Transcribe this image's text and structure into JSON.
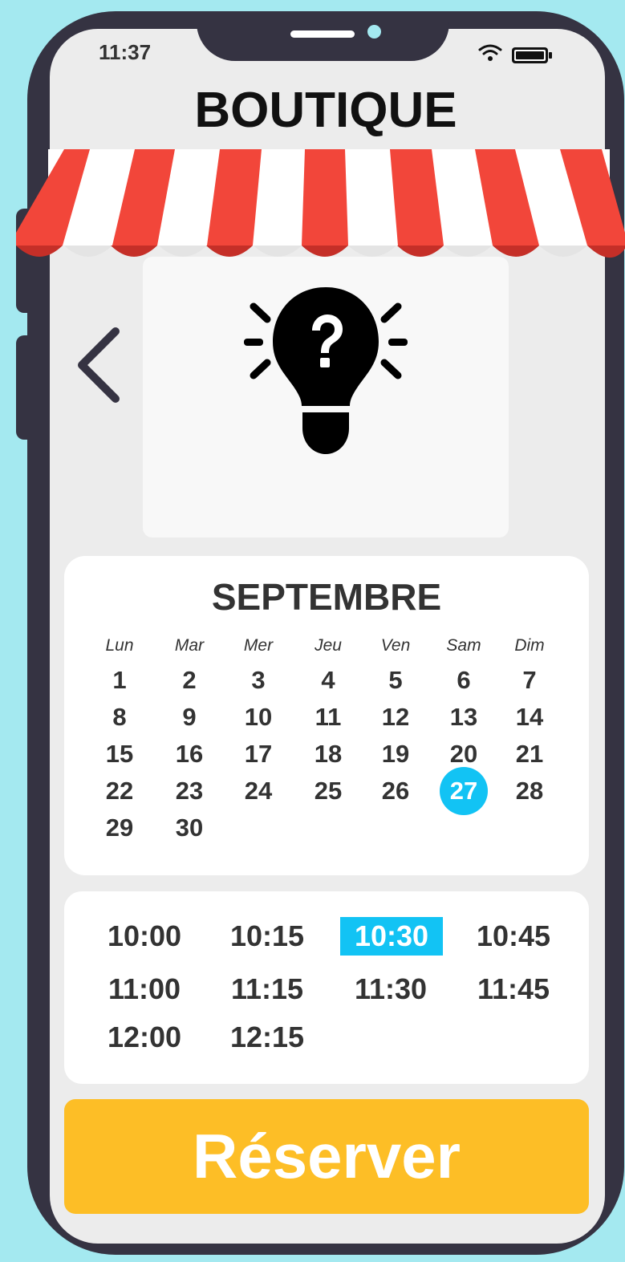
{
  "status_bar": {
    "time": "11:37"
  },
  "header": {
    "title": "BOUTIQUE"
  },
  "calendar": {
    "month": "SEPTEMBRE",
    "weekdays": [
      "Lun",
      "Mar",
      "Mer",
      "Jeu",
      "Ven",
      "Sam",
      "Dim"
    ],
    "days": [
      "1",
      "2",
      "3",
      "4",
      "5",
      "6",
      "7",
      "8",
      "9",
      "10",
      "11",
      "12",
      "13",
      "14",
      "15",
      "16",
      "17",
      "18",
      "19",
      "20",
      "21",
      "22",
      "23",
      "24",
      "25",
      "26",
      "27",
      "28",
      "29",
      "30"
    ],
    "selected_day": "27"
  },
  "time_slots": {
    "slots": [
      "10:00",
      "10:15",
      "10:30",
      "10:45",
      "11:00",
      "11:15",
      "11:30",
      "11:45",
      "12:00",
      "12:15"
    ],
    "selected": "10:30"
  },
  "actions": {
    "reserve_label": "Réserver"
  },
  "colors": {
    "background": "#a4e9f0",
    "phone": "#353342",
    "accent": "#12c3f4",
    "reserve_button": "#fdbe26",
    "awning_red": "#f2463a"
  },
  "icons": [
    "back-chevron-icon",
    "lightbulb-question-icon",
    "wifi-icon",
    "battery-icon"
  ]
}
